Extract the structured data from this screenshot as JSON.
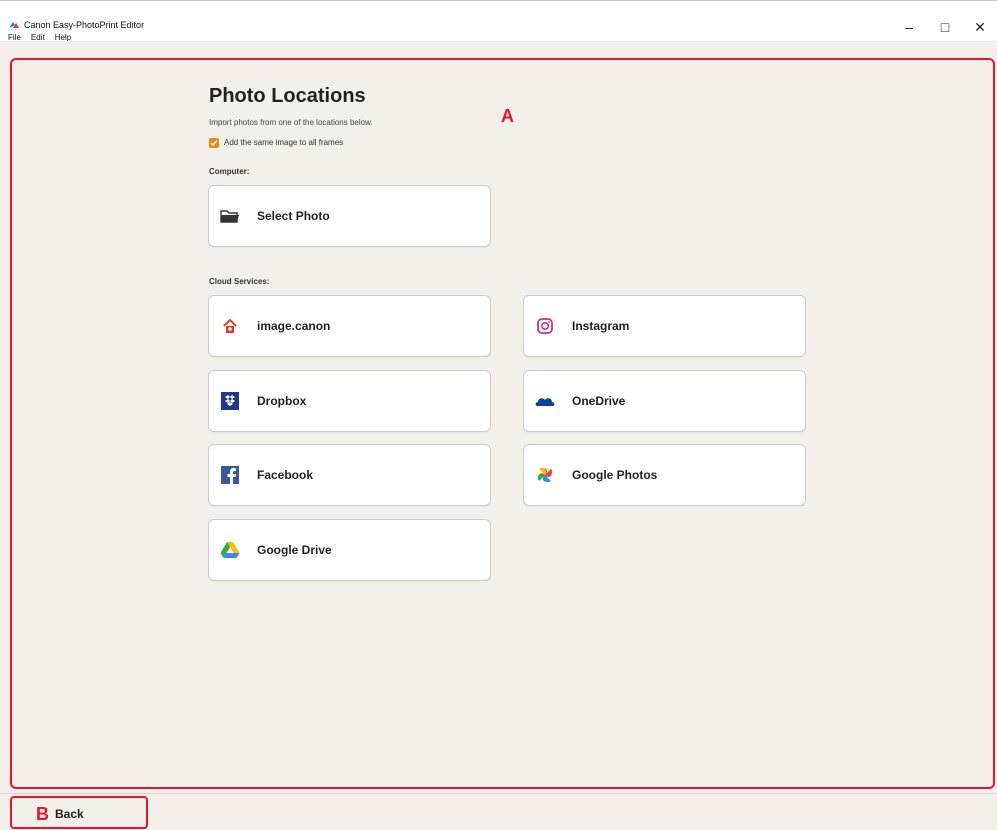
{
  "window": {
    "title": "Canon Easy-PhotoPrint Editor",
    "minimize": "–",
    "maximize": "□",
    "close": "✕"
  },
  "menu": [
    "File",
    "Edit",
    "Help"
  ],
  "annotations": {
    "a": "A",
    "b": "B"
  },
  "main": {
    "heading": "Photo Locations",
    "subtitle": "Import photos from one of the locations below.",
    "checkbox": {
      "label": "Add the same image to all frames",
      "checked": true
    },
    "computer_label": "Computer:",
    "select_photo": "Select Photo",
    "cloud_label": "Cloud Services:",
    "services": [
      {
        "label": "image.canon",
        "icon": "image-canon-icon"
      },
      {
        "label": "Instagram",
        "icon": "instagram-icon"
      },
      {
        "label": "Dropbox",
        "icon": "dropbox-icon"
      },
      {
        "label": "OneDrive",
        "icon": "onedrive-icon"
      },
      {
        "label": "Facebook",
        "icon": "facebook-icon"
      },
      {
        "label": "Google Photos",
        "icon": "google-photos-icon"
      },
      {
        "label": "Google Drive",
        "icon": "google-drive-icon"
      }
    ]
  },
  "footer": {
    "back_label": "Back"
  },
  "colors": {
    "accent": "#e88a1a",
    "annotation": "#e8152b",
    "background": "#f3efea"
  }
}
